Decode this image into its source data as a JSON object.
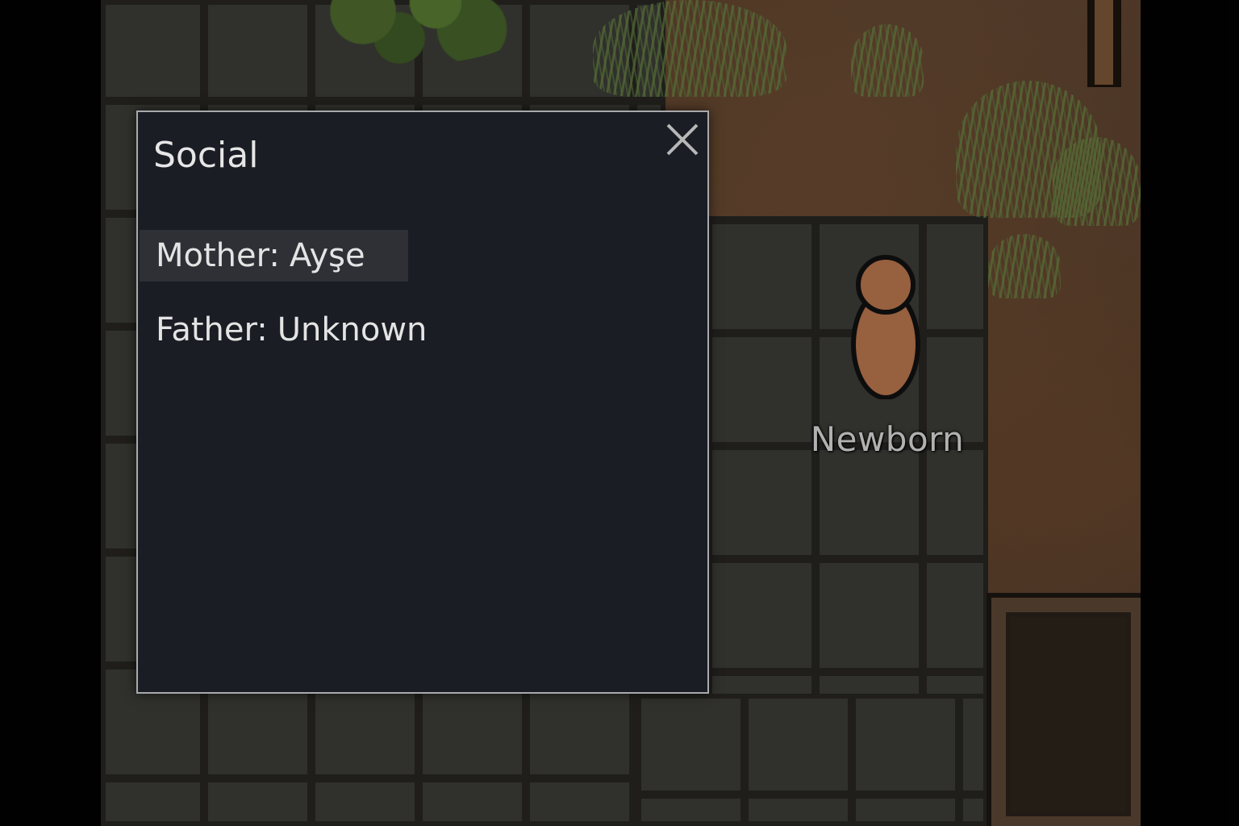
{
  "social_window": {
    "title": "Social",
    "close_icon": "close-icon",
    "relations": [
      {
        "label": "Mother:",
        "value": "Ayşe",
        "highlighted": true
      },
      {
        "label": "Father:",
        "value": "Unknown",
        "highlighted": false
      }
    ]
  },
  "map": {
    "pawn": {
      "name": "Newborn",
      "skin_color": "#b9764e",
      "outline_color": "#111111"
    }
  },
  "colors": {
    "window_bg": "#1b1d25",
    "window_border": "#a8a9ad",
    "row_highlight": "#2e3036",
    "text": "#e4e4e4"
  }
}
